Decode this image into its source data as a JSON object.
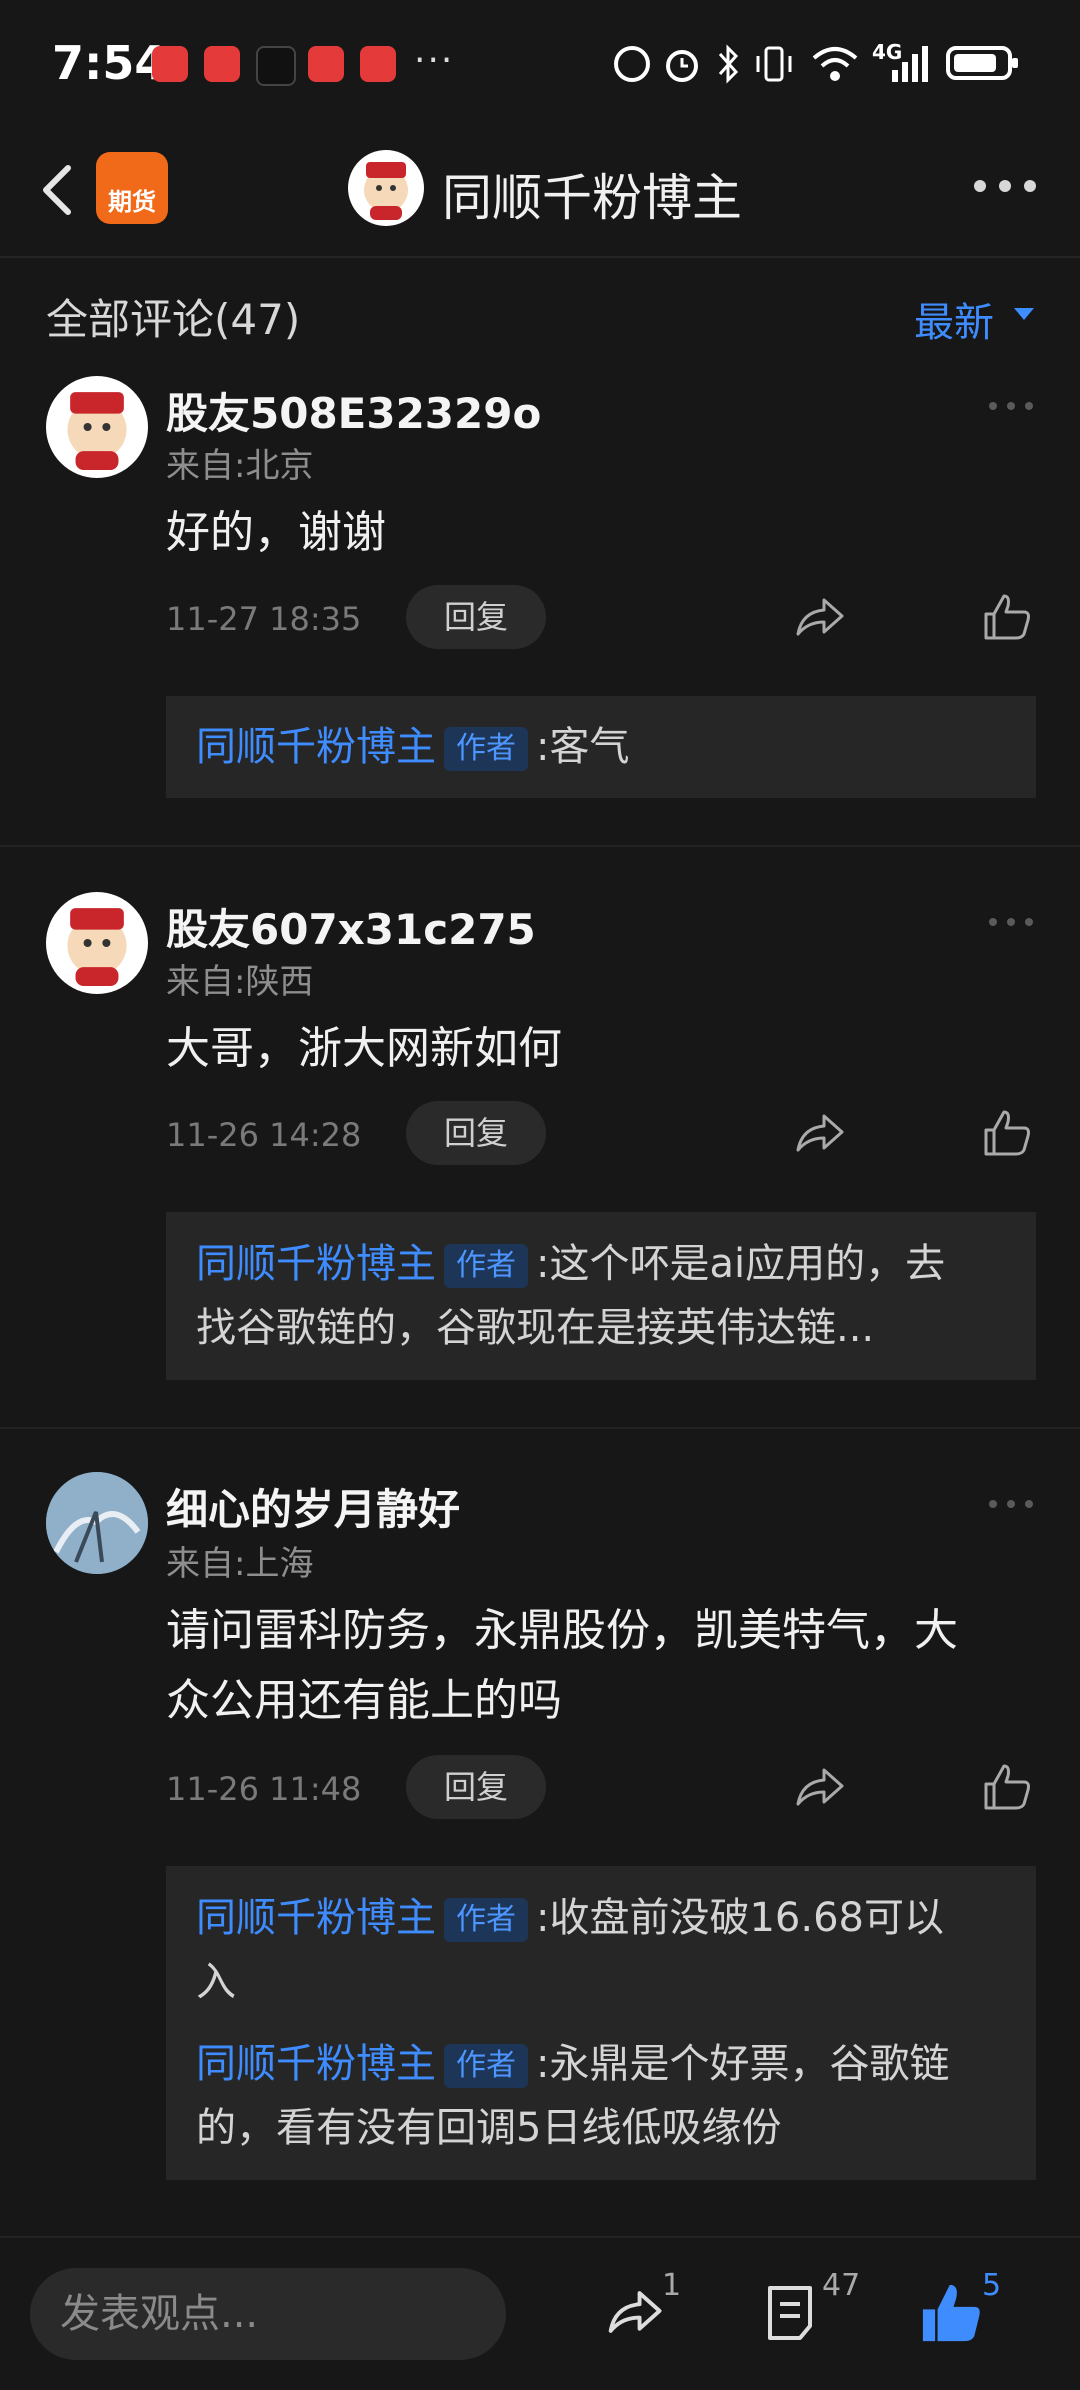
{
  "status_bar": {
    "time": "7:54",
    "notification_icons": [
      "huawei-icon",
      "huawei-icon",
      "tiktok-icon",
      "app-icon",
      "app-icon"
    ],
    "more": "···",
    "network": "4G"
  },
  "header": {
    "title": "同顺千粉博主",
    "futures_badge": "期货"
  },
  "comments_header": {
    "title": "全部评论(47)",
    "sort_label": "最新"
  },
  "comments": [
    {
      "user": "股友508E32329o",
      "location": "来自:北京",
      "text": "好的，谢谢",
      "date": "11-27 18:35",
      "reply_label": "回复",
      "replies": [
        {
          "name": "同顺千粉博主",
          "tag": "作者",
          "text": ":客气"
        }
      ]
    },
    {
      "user": "股友607x31c275",
      "location": "来自:陕西",
      "text": "大哥，浙大网新如何",
      "date": "11-26 14:28",
      "reply_label": "回复",
      "replies": [
        {
          "name": "同顺千粉博主",
          "tag": "作者",
          "text": ":这个吥是ai应用的，去",
          "text2": "找谷歌链的，谷歌现在是接英伟达链..."
        }
      ]
    },
    {
      "user": "细心的岁月静好",
      "location": "来自:上海",
      "text": "请问雷科防务，永鼎股份，凯美特气，大",
      "text2": "众公用还有能上的吗",
      "date": "11-26 11:48",
      "reply_label": "回复",
      "replies": [
        {
          "name": "同顺千粉博主",
          "tag": "作者",
          "text": ":收盘前没破16.68可以",
          "text2": "入"
        },
        {
          "name": "同顺千粉博主",
          "tag": "作者",
          "text": ":永鼎是个好票，谷歌链",
          "text2": "的，看有没有回调5日线低吸缘份"
        }
      ]
    }
  ],
  "bottom_bar": {
    "input_placeholder": "发表观点...",
    "share_count": "1",
    "comment_count": "47",
    "like_count": "5"
  },
  "colors": {
    "background": "#171717",
    "accent_blue": "#3f8cff",
    "futures_orange": "#f06a1a"
  }
}
